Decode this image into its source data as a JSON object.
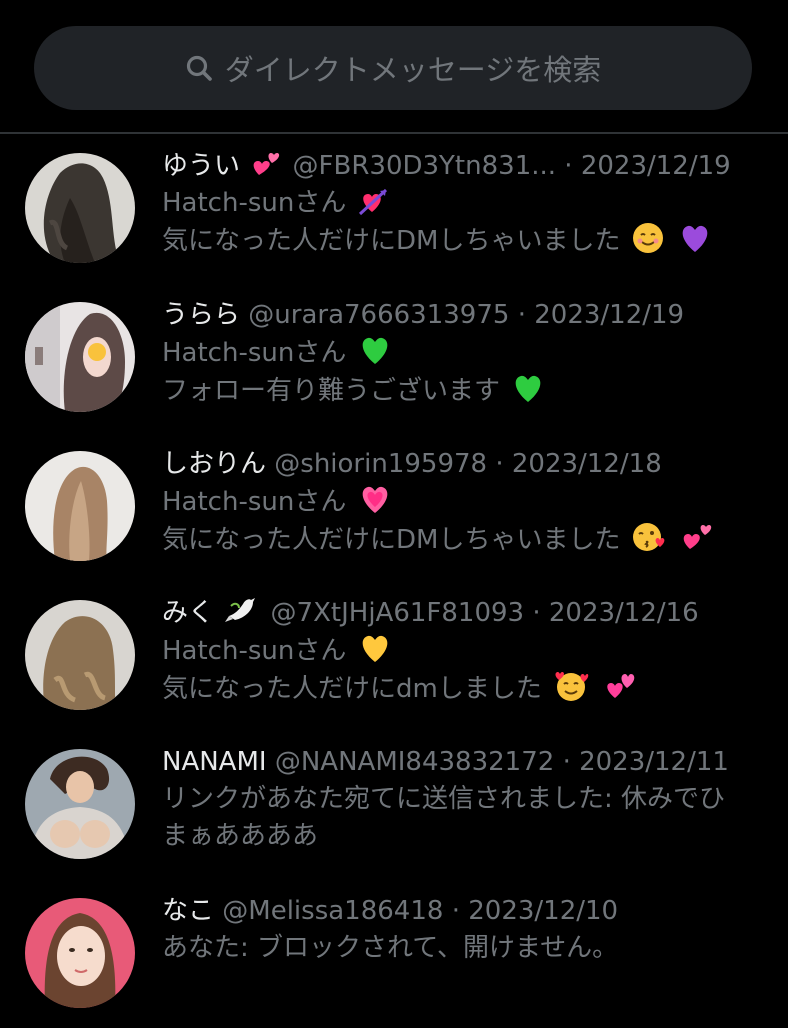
{
  "search": {
    "placeholder": "ダイレクトメッセージを検索",
    "icon": "search-icon"
  },
  "conversations": [
    {
      "name": "ゆうい",
      "name_emoji": "revolving-hearts",
      "handle": "@FBR30D3Ytn831...",
      "date": "· 2023/12/19",
      "line1": "Hatch-sunさん",
      "line1_emoji": "heart-with-arrow",
      "line2": "気になった人だけにDMしちゃいました",
      "line2_emojis": [
        "smiling-face",
        "purple-heart"
      ]
    },
    {
      "name": "うらら",
      "name_emoji": "",
      "handle": "@urara7666313975",
      "date": "· 2023/12/19",
      "line1": "Hatch-sunさん",
      "line1_emoji": "green-heart",
      "line2": "フォロー有り難うございます",
      "line2_emojis": [
        "green-heart"
      ]
    },
    {
      "name": "しおりん",
      "name_emoji": "",
      "handle": "@shiorin195978",
      "date": "· 2023/12/18",
      "line1": "Hatch-sunさん",
      "line1_emoji": "growing-heart",
      "line2": "気になった人だけにDMしちゃいました",
      "line2_emojis": [
        "kissing-face",
        "revolving-hearts"
      ]
    },
    {
      "name": "みく",
      "name_emoji": "dove",
      "handle": "@7XtJHjA61F81093",
      "date": "· 2023/12/16",
      "line1": "Hatch-sunさん",
      "line1_emoji": "yellow-heart",
      "line2": "気になった人だけにdmしました",
      "line2_emojis": [
        "smiling-face-with-hearts",
        "two-hearts"
      ]
    },
    {
      "name": "NANAMI",
      "name_emoji": "",
      "handle": "@NANAMI843832172",
      "date": "· 2023/12/11",
      "line1": "リンクがあなた宛てに送信されました: 休みでひ",
      "line1_emoji": "",
      "line2": "まぁああああ",
      "line2_emojis": []
    },
    {
      "name": "なこ",
      "name_emoji": "",
      "handle": "@Melissa186418",
      "date": "· 2023/12/10",
      "line1": "あなた: ブロックされて、開けません。",
      "line1_emoji": "",
      "line2": "",
      "line2_emojis": []
    }
  ]
}
